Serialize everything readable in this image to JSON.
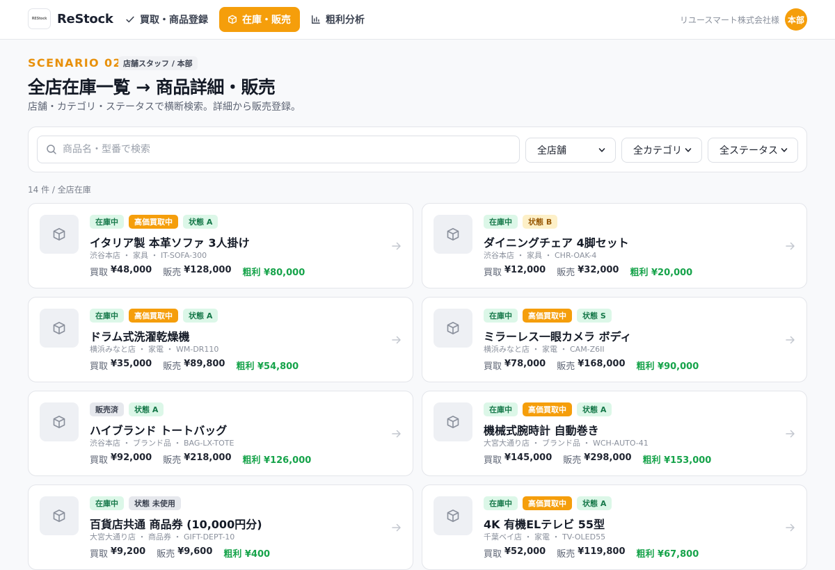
{
  "header": {
    "logo_text": "REStock",
    "brand": "ReStock",
    "nav": [
      {
        "label": "買取・商品登録",
        "icon": "check-icon",
        "active": false
      },
      {
        "label": "在庫・販売",
        "icon": "box-icon",
        "active": true
      },
      {
        "label": "粗利分析",
        "icon": "bar-chart-icon",
        "active": false
      }
    ],
    "company": "リユースマート株式会社様",
    "avatar": "本部"
  },
  "page": {
    "scenario": "SCENARIO 02",
    "role": "店舗スタッフ / 本部",
    "title": "全店在庫一覧 → 商品詳細・販売",
    "subtitle": "店舗・カテゴリ・ステータスで横断検索。詳細から販売登録。"
  },
  "filters": {
    "search_placeholder": "商品名・型番で検索",
    "search_value": "",
    "store": "全店舗",
    "category": "全カテゴリ",
    "status": "全ステータス"
  },
  "result_count": "14 件 / 全店在庫",
  "labels": {
    "buy": "買取",
    "sell": "販売",
    "profit": "粗利"
  },
  "colors": {
    "accent": "#f59e0b",
    "profit": "#16a34a",
    "stock_badge": "#dcf7e8"
  },
  "items": [
    {
      "badges": [
        {
          "text": "在庫中",
          "type": "stock"
        },
        {
          "text": "高価買取中",
          "type": "high"
        },
        {
          "text": "状態 A",
          "type": "cond"
        }
      ],
      "name": "イタリア製 本革ソファ 3人掛け",
      "meta": "渋谷本店 ・ 家具 ・ IT-SOFA-300",
      "buy": "¥48,000",
      "sell": "¥128,000",
      "profit": "粗利 ¥80,000"
    },
    {
      "badges": [
        {
          "text": "在庫中",
          "type": "stock"
        },
        {
          "text": "状態 B",
          "type": "condB"
        }
      ],
      "name": "ダイニングチェア 4脚セット",
      "meta": "渋谷本店 ・ 家具 ・ CHR-OAK-4",
      "buy": "¥12,000",
      "sell": "¥32,000",
      "profit": "粗利 ¥20,000"
    },
    {
      "badges": [
        {
          "text": "在庫中",
          "type": "stock"
        },
        {
          "text": "高価買取中",
          "type": "high"
        },
        {
          "text": "状態 A",
          "type": "cond"
        }
      ],
      "name": "ドラム式洗濯乾燥機",
      "meta": "横浜みなと店 ・ 家電 ・ WM-DR110",
      "buy": "¥35,000",
      "sell": "¥89,800",
      "profit": "粗利 ¥54,800"
    },
    {
      "badges": [
        {
          "text": "在庫中",
          "type": "stock"
        },
        {
          "text": "高価買取中",
          "type": "high"
        },
        {
          "text": "状態 S",
          "type": "cond"
        }
      ],
      "name": "ミラーレス一眼カメラ ボディ",
      "meta": "横浜みなと店 ・ 家電 ・ CAM-Z6II",
      "buy": "¥78,000",
      "sell": "¥168,000",
      "profit": "粗利 ¥90,000"
    },
    {
      "badges": [
        {
          "text": "販売済",
          "type": "sold"
        },
        {
          "text": "状態 A",
          "type": "cond"
        }
      ],
      "name": "ハイブランド トートバッグ",
      "meta": "渋谷本店 ・ ブランド品 ・ BAG-LX-TOTE",
      "buy": "¥92,000",
      "sell": "¥218,000",
      "profit": "粗利 ¥126,000"
    },
    {
      "badges": [
        {
          "text": "在庫中",
          "type": "stock"
        },
        {
          "text": "高価買取中",
          "type": "high"
        },
        {
          "text": "状態 A",
          "type": "cond"
        }
      ],
      "name": "機械式腕時計 自動巻き",
      "meta": "大宮大通り店 ・ ブランド品 ・ WCH-AUTO-41",
      "buy": "¥145,000",
      "sell": "¥298,000",
      "profit": "粗利 ¥153,000"
    },
    {
      "badges": [
        {
          "text": "在庫中",
          "type": "stock"
        },
        {
          "text": "状態 未使用",
          "type": "condU"
        }
      ],
      "name": "百貨店共通 商品券 (10,000円分)",
      "meta": "大宮大通り店 ・ 商品券 ・ GIFT-DEPT-10",
      "buy": "¥9,200",
      "sell": "¥9,600",
      "profit": "粗利 ¥400"
    },
    {
      "badges": [
        {
          "text": "在庫中",
          "type": "stock"
        },
        {
          "text": "高価買取中",
          "type": "high"
        },
        {
          "text": "状態 A",
          "type": "cond"
        }
      ],
      "name": "4K 有機ELテレビ 55型",
      "meta": "千葉ベイ店 ・ 家電 ・ TV-OLED55",
      "buy": "¥52,000",
      "sell": "¥119,800",
      "profit": "粗利 ¥67,800"
    }
  ]
}
